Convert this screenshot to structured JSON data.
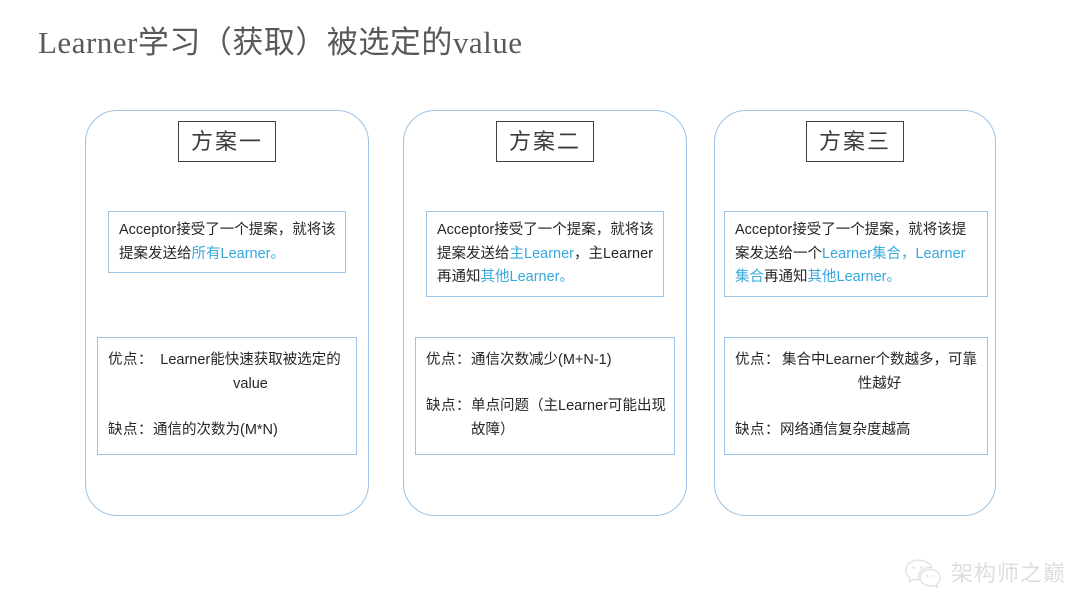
{
  "slide": {
    "title": "Learner学习（获取）被选定的value"
  },
  "cards": [
    {
      "header": "方案一",
      "description": {
        "segments": [
          {
            "text": "Acceptor接受了一个提案，就将该提案发送给",
            "highlight": false
          },
          {
            "text": "所有Learner",
            "highlight": true
          },
          {
            "text": "。",
            "highlight": true
          }
        ]
      },
      "pros": {
        "label": "优点：",
        "value": "Learner能快速获取被选定的value",
        "align": "center"
      },
      "cons": {
        "label": "缺点：",
        "value": "通信的次数为(M*N)",
        "align": "left"
      }
    },
    {
      "header": "方案二",
      "description": {
        "segments": [
          {
            "text": "Acceptor接受了一个提案，就将该提案发送给",
            "highlight": false
          },
          {
            "text": "主Learner",
            "highlight": true
          },
          {
            "text": "，主Learner再通知",
            "highlight": false
          },
          {
            "text": "其他Learner",
            "highlight": true
          },
          {
            "text": "。",
            "highlight": true
          }
        ]
      },
      "pros": {
        "label": "优点：",
        "value": "通信次数减少(M+N-1)",
        "align": "left"
      },
      "cons": {
        "label": "缺点：",
        "value": "单点问题（主Learner可能出现故障）",
        "align": "left"
      }
    },
    {
      "header": "方案三",
      "description": {
        "segments": [
          {
            "text": "Acceptor接受了一个提案，就将该提案发送给一个",
            "highlight": false
          },
          {
            "text": "Learner集合",
            "highlight": true
          },
          {
            "text": "，",
            "highlight": true
          },
          {
            "text": "Learner集合",
            "highlight": true
          },
          {
            "text": "再通知",
            "highlight": false
          },
          {
            "text": "其他Learner",
            "highlight": true
          },
          {
            "text": "。",
            "highlight": true
          }
        ]
      },
      "pros": {
        "label": "优点：",
        "value": "集合中Learner个数越多，可靠性越好",
        "align": "center"
      },
      "cons": {
        "label": "缺点：",
        "value": "网络通信复杂度越高",
        "align": "left"
      }
    }
  ],
  "watermark": {
    "text": "架构师之巅",
    "icon": "wechat-icon",
    "color": "#d2d2d2"
  },
  "colors": {
    "highlight_blue": "#35a8dd",
    "card_border": "#9dc3e6",
    "title_gray": "#595959"
  }
}
